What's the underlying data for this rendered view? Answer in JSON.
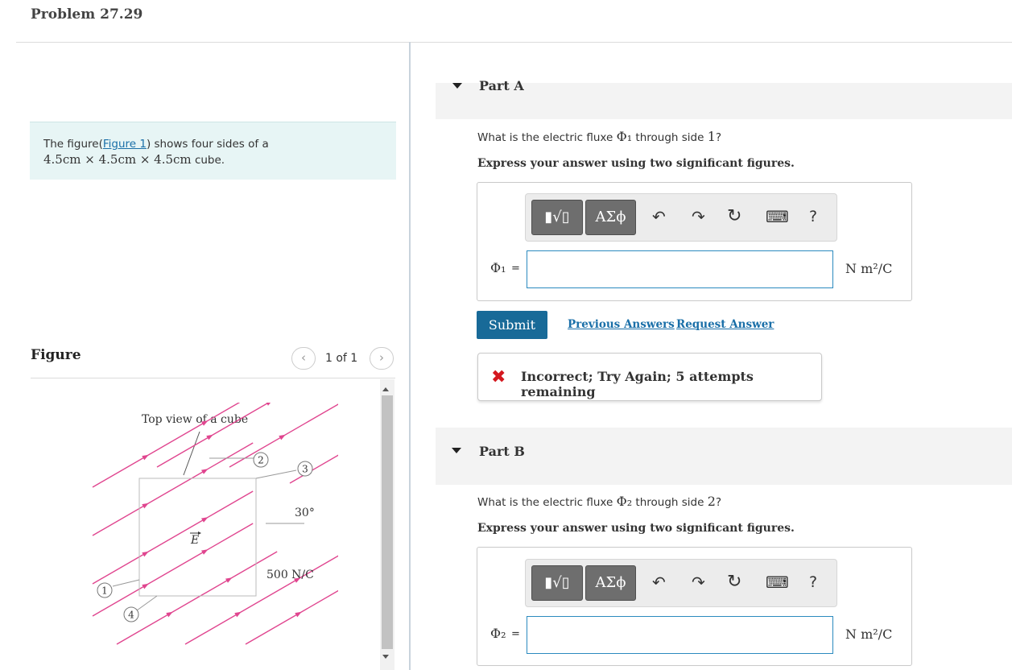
{
  "problem": {
    "title": "Problem 27.29"
  },
  "prompt": {
    "text_before": "The figure(",
    "figure_link": "Figure 1",
    "text_after": ") shows four sides of a",
    "dimensions": "4.5cm × 4.5cm × 4.5cm",
    "suffix": " cube."
  },
  "figure": {
    "label": "Figure",
    "pager": "1 of 1",
    "prev_icon": "‹",
    "next_icon": "›",
    "caption": "Top view of a cube",
    "angle_label": "30°",
    "field_label": "E",
    "field_value": "500 N/C",
    "side_labels": [
      "1",
      "2",
      "3",
      "4"
    ]
  },
  "toolbar": {
    "templates_label": "▮√▯",
    "greek_label": "ΑΣϕ",
    "undo_icon": "↶",
    "redo_icon": "↷",
    "reset_icon": "↻",
    "keyboard_icon": "⌨",
    "help_label": "?"
  },
  "parts": [
    {
      "title": "Part A",
      "question_before": "What is the electric fluxe ",
      "question_symbol": "Φ₁",
      "question_middle": " through side ",
      "question_side": "1",
      "question_end": "?",
      "instruction": "Express your answer using two significant figures.",
      "symbol": "Φ₁",
      "equals": "=",
      "input_value": "",
      "unit": "N m²/C",
      "submit_label": "Submit",
      "previous_answers": "Previous Answers",
      "request_answer": "Request Answer",
      "feedback": "Incorrect; Try Again; 5 attempts remaining",
      "feedback_icon": "✖"
    },
    {
      "title": "Part B",
      "question_before": "What is the electric fluxe ",
      "question_symbol": "Φ₂",
      "question_middle": " through side ",
      "question_side": "2",
      "question_end": "?",
      "instruction": "Express your answer using two significant figures.",
      "symbol": "Φ₂",
      "equals": "=",
      "input_value": "",
      "unit": "N m²/C"
    }
  ],
  "colors": {
    "accent": "#186a98",
    "link": "#1a6fa8",
    "error": "#d4181f",
    "field_lines": "#e0458f"
  }
}
